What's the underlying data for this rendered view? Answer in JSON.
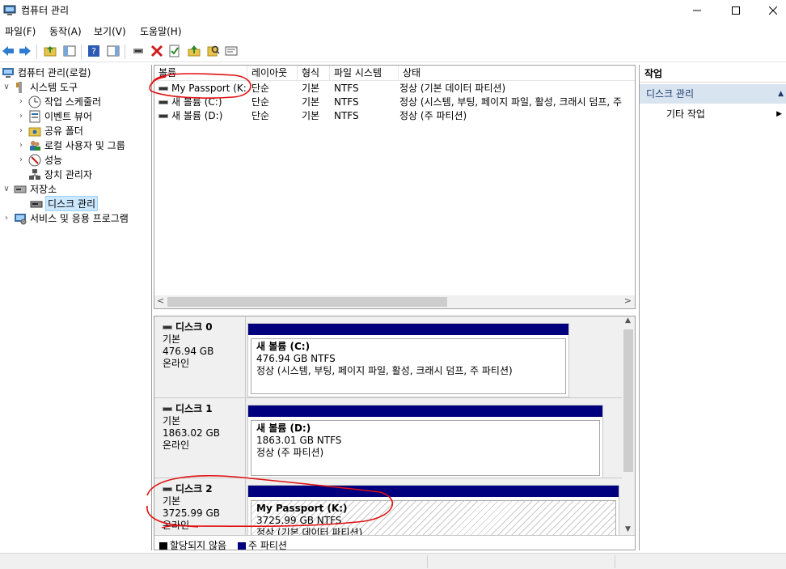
{
  "window": {
    "title": "컴퓨터 관리",
    "controls": [
      "minimize-icon",
      "maximize-icon",
      "close-icon"
    ]
  },
  "menu": [
    "파일(F)",
    "동작(A)",
    "보기(V)",
    "도움말(H)"
  ],
  "toolbar": [
    "back-icon",
    "forward-icon",
    "up-folder-icon",
    "show-hide-console-tree-icon",
    "help-icon",
    "show-hide-action-pane-icon",
    "connect-icon",
    "delete-icon",
    "properties-icon",
    "export-icon",
    "search-icon",
    "rescan-icon"
  ],
  "tree": {
    "root": "컴퓨터 관리(로컬)",
    "system_tools": "시스템 도구",
    "task_scheduler": "작업 스케줄러",
    "event_viewer": "이벤트 뷰어",
    "shared_folders": "공유 폴더",
    "local_users": "로컬 사용자 및 그룹",
    "performance": "성능",
    "device_manager": "장치 관리자",
    "storage": "저장소",
    "disk_management": "디스크 관리",
    "services": "서비스 및 응용 프로그램"
  },
  "volumes": {
    "columns": [
      "볼륨",
      "레이아웃",
      "형식",
      "파일 시스템",
      "상태"
    ],
    "rows": [
      {
        "name": "My Passport (K:)",
        "layout": "단순",
        "type": "기본",
        "fs": "NTFS",
        "status": "정상 (기본 데이터 파티션)"
      },
      {
        "name": "새 볼륨 (C:)",
        "layout": "단순",
        "type": "기본",
        "fs": "NTFS",
        "status": "정상 (시스템, 부팅, 페이지 파일, 활성, 크래시 덤프, 주"
      },
      {
        "name": "새 볼륨 (D:)",
        "layout": "단순",
        "type": "기본",
        "fs": "NTFS",
        "status": "정상 (주 파티션)"
      }
    ]
  },
  "disks": [
    {
      "title": "디스크 0",
      "type": "기본",
      "size": "476.94 GB",
      "state": "온라인",
      "partition": {
        "name": "새 볼륨  (C:)",
        "size": "476.94 GB NTFS",
        "status": "정상 (시스템, 부팅, 페이지 파일, 활성, 크래시 덤프, 주 파티션)"
      }
    },
    {
      "title": "디스크 1",
      "type": "기본",
      "size": "1863.02 GB",
      "state": "온라인",
      "partition": {
        "name": "새 볼륨  (D:)",
        "size": "1863.01 GB NTFS",
        "status": "정상 (주 파티션)"
      }
    },
    {
      "title": "디스크 2",
      "type": "기본",
      "size": "3725.99 GB",
      "state": "온라인",
      "partition": {
        "name": "My Passport  (K:)",
        "size": "3725.99 GB NTFS",
        "status": "정상 (기본 데이터 파티션)"
      }
    }
  ],
  "legend": {
    "unallocated": "할당되지 않음",
    "primary": "주 파티션",
    "unallocated_color": "#000000",
    "primary_color": "#00007e"
  },
  "actions": {
    "header": "작업",
    "section": "디스크 관리",
    "more": "기타 작업"
  },
  "annotation_color": "#e01010"
}
